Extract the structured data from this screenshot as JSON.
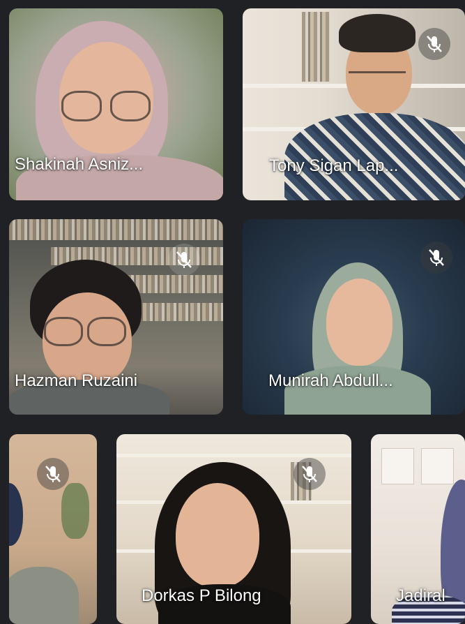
{
  "call": {
    "participants": [
      {
        "name": "Shakinah Asniz...",
        "muted": false
      },
      {
        "name": "Tony Sigan Lap...",
        "muted": true
      },
      {
        "name": "Hazman Ruzaini",
        "muted": true
      },
      {
        "name": "Munirah Abdull...",
        "muted": true
      },
      {
        "name": "",
        "muted": true
      },
      {
        "name": "Dorkas P Bilong",
        "muted": true
      },
      {
        "name": "Jadiral",
        "muted": false
      }
    ]
  },
  "icons": {
    "mic_off": "mic-off-icon"
  },
  "colors": {
    "background": "#202124",
    "name_text": "#ffffff"
  }
}
